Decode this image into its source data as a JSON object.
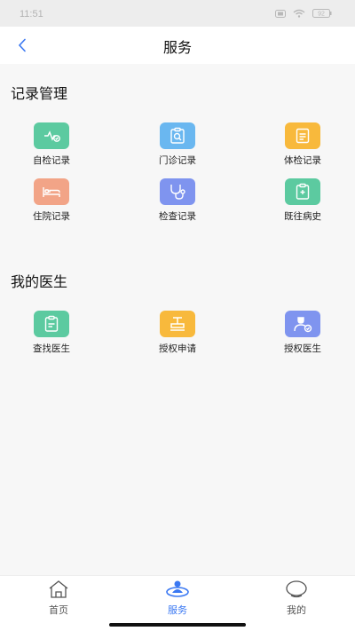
{
  "status": {
    "time": "11:51",
    "battery": "92"
  },
  "header": {
    "title": "服务",
    "back_icon": "chevron-left-icon"
  },
  "records": {
    "title": "记录管理",
    "items": [
      {
        "label": "自检记录",
        "icon": "self-check-icon",
        "color": "#5ccaa0"
      },
      {
        "label": "门诊记录",
        "icon": "outpatient-icon",
        "color": "#6ab7f0"
      },
      {
        "label": "体检记录",
        "icon": "physical-exam-icon",
        "color": "#f8b93c"
      },
      {
        "label": "住院记录",
        "icon": "hospital-bed-icon",
        "color": "#f2a487"
      },
      {
        "label": "检查记录",
        "icon": "stethoscope-icon",
        "color": "#7f94ef"
      },
      {
        "label": "既往病史",
        "icon": "medical-history-icon",
        "color": "#5ccaa0"
      }
    ]
  },
  "doctors": {
    "title": "我的医生",
    "items": [
      {
        "label": "查找医生",
        "icon": "find-doctor-icon",
        "color": "#5ccaa0"
      },
      {
        "label": "授权申请",
        "icon": "stamp-icon",
        "color": "#f8b93c"
      },
      {
        "label": "授权医生",
        "icon": "authorized-doctor-icon",
        "color": "#7f94ef"
      }
    ]
  },
  "tabs": [
    {
      "label": "首页",
      "icon": "home-icon",
      "active": false
    },
    {
      "label": "服务",
      "icon": "service-icon",
      "active": true
    },
    {
      "label": "我的",
      "icon": "profile-icon",
      "active": false
    }
  ],
  "colors": {
    "accent": "#3a78f2",
    "inactive": "#555555"
  }
}
